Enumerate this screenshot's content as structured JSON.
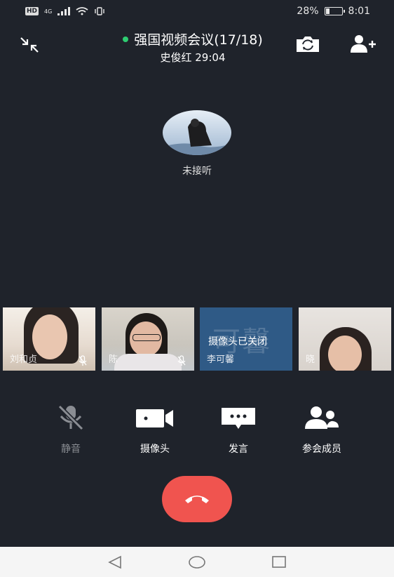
{
  "status_bar": {
    "network": "4G",
    "battery_text": "28%",
    "time": "8:01"
  },
  "header": {
    "title": "强国视频会议(17/18)",
    "subtitle": "史俊红 29:04"
  },
  "callee": {
    "status": "未接听"
  },
  "participants": [
    {
      "name": "刘和贞",
      "mic": "mic-muted-icon"
    },
    {
      "name": "陈",
      "mic": "mic-muted-icon"
    },
    {
      "name": "李可馨",
      "overlay_text": "摄像头已关闭",
      "bg_text": "可馨"
    },
    {
      "name": "晓"
    }
  ],
  "controls": {
    "mute": "静音",
    "camera": "摄像头",
    "speak": "发言",
    "members": "参会成员"
  },
  "colors": {
    "background": "#1f232b",
    "hangup": "#f0544f",
    "online_dot": "#2ecc71"
  }
}
